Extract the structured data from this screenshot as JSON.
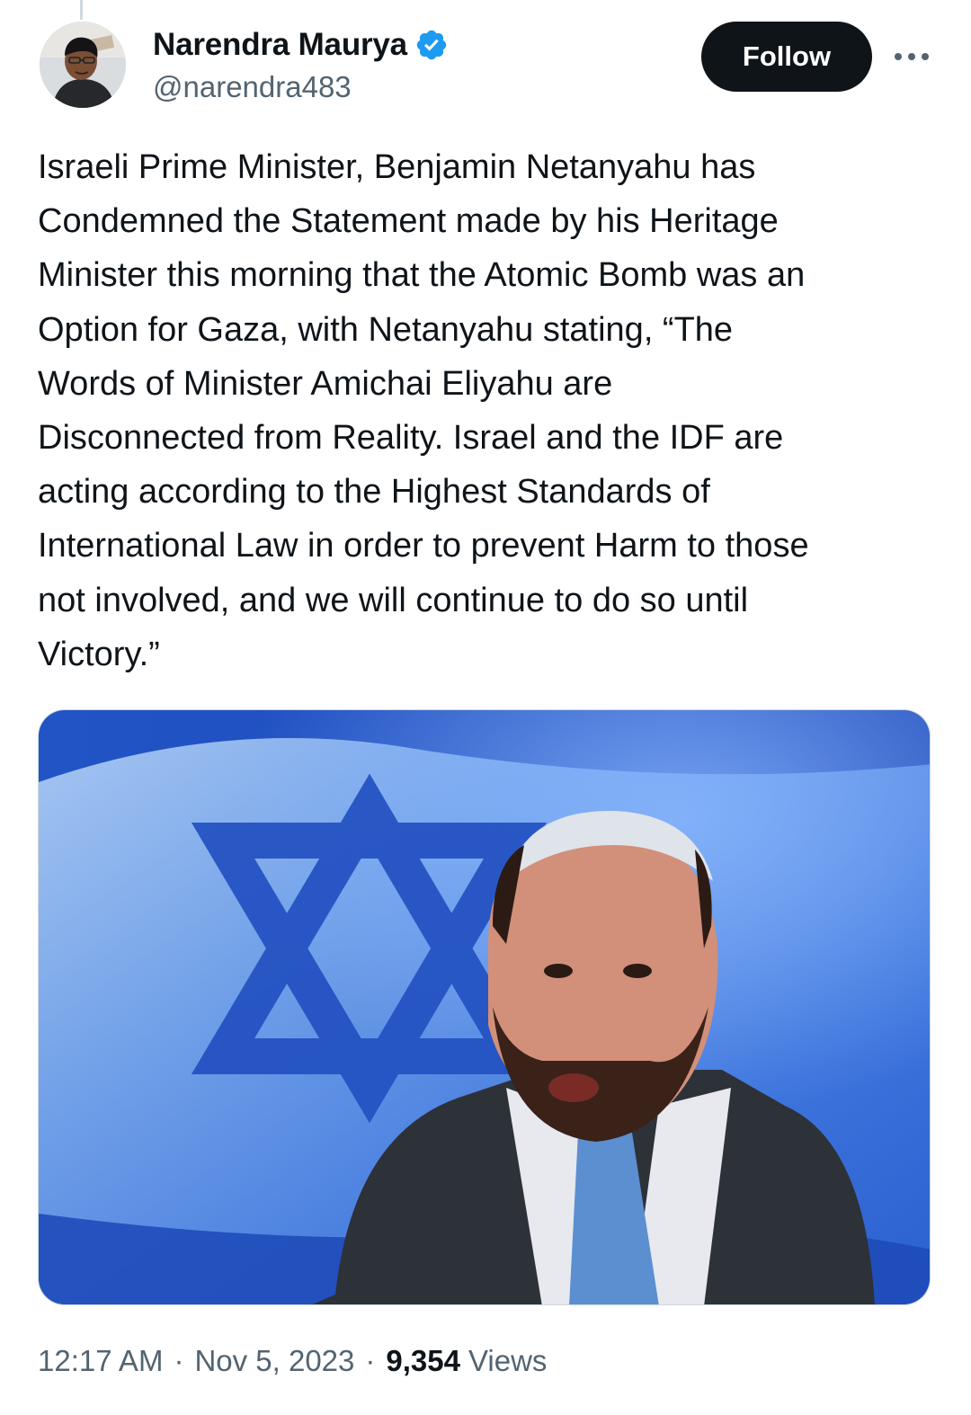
{
  "author": {
    "display_name": "Narendra Maurya",
    "handle": "@narendra483",
    "verified": true
  },
  "header": {
    "follow_label": "Follow"
  },
  "tweet": {
    "text": "Israeli Prime Minister, Benjamin Netanyahu has\nCondemned the Statement made by his Heritage\nMinister this morning that the Atomic Bomb was an\nOption for Gaza, with Netanyahu stating, “The\nWords of Minister Amichai Eliyahu are\nDisconnected from Reality. Israel and the IDF are\nacting according to the Highest Standards of\nInternational Law in order to prevent Harm to those\nnot involved, and we will continue to do so until\nVictory.”"
  },
  "meta": {
    "time": "12:17 AM",
    "separator": "·",
    "date": "Nov 5, 2023",
    "views_count": "9,354",
    "views_label": "Views"
  },
  "icons": {
    "verified": "verified-badge-icon",
    "more": "more-horizontal-icon"
  },
  "colors": {
    "text_primary": "#0f1419",
    "text_secondary": "#536471",
    "verified_blue": "#1d9bf0",
    "follow_bg": "#0f1419",
    "follow_text": "#ffffff"
  }
}
